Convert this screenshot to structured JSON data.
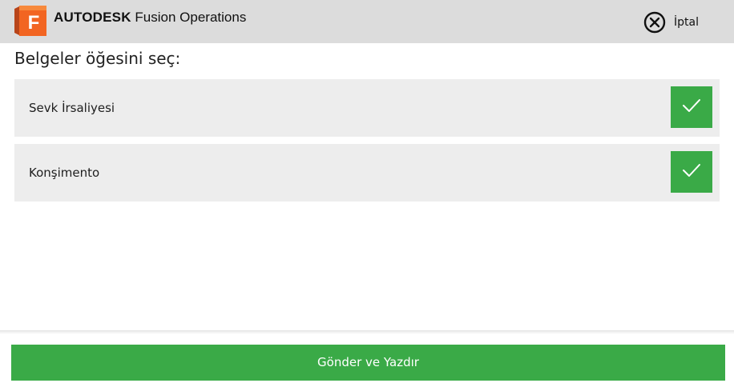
{
  "header": {
    "brand_bold": "AUTODESK",
    "brand_rest": "Fusion Operations",
    "logo_letter": "F",
    "logo_icon": "fusion-logo-icon",
    "cancel_icon": "close-circle-icon",
    "cancel_label": "İptal"
  },
  "main": {
    "prompt": "Belgeler öğesini seç:",
    "documents": [
      {
        "label": "Sevk İrsaliyesi",
        "selected": true
      },
      {
        "label": "Konşimento",
        "selected": true
      }
    ],
    "check_icon": "checkmark-icon"
  },
  "footer": {
    "submit_label": "Gönder ve Yazdır"
  },
  "colors": {
    "header_bg": "#dcdcdc",
    "row_bg": "#ededed",
    "accent_green": "#3aaa47",
    "logo_orange": "#f26522"
  }
}
